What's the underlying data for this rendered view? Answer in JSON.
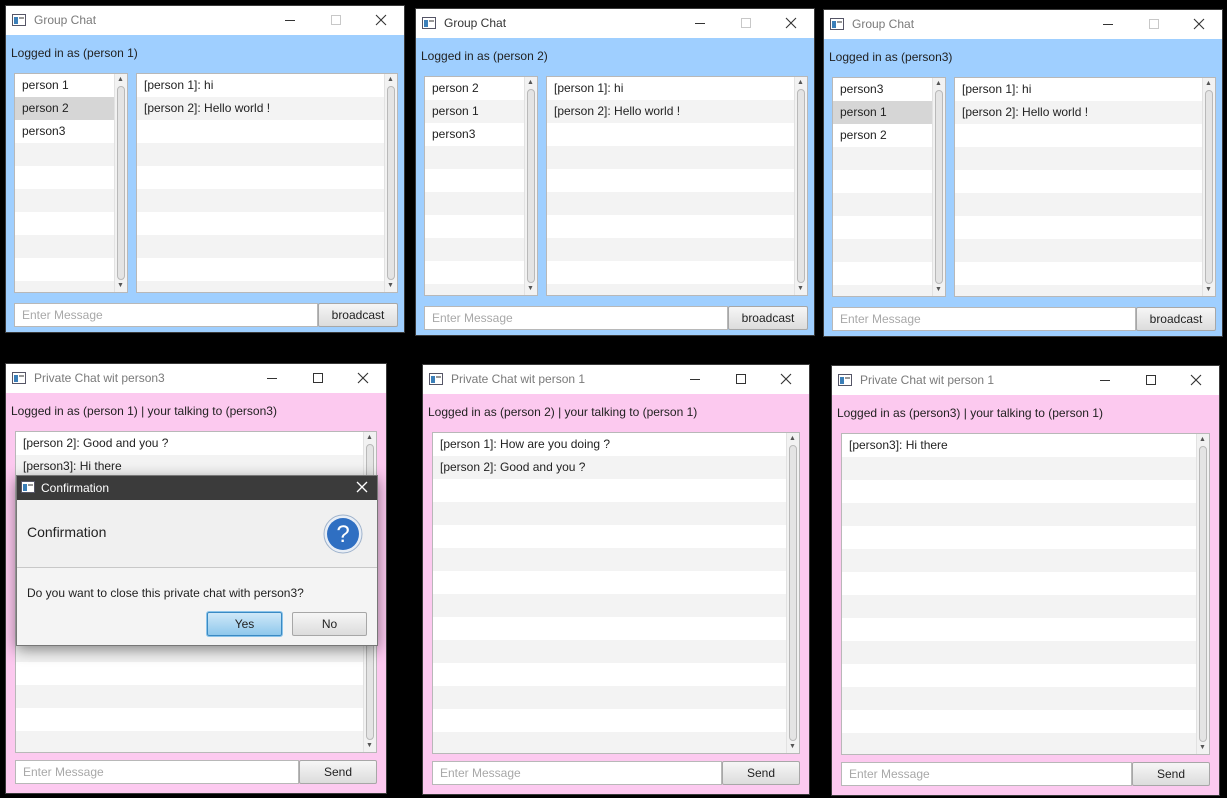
{
  "group_windows": [
    {
      "title": "Group Chat",
      "status": "Logged in as (person 1)",
      "users": [
        "person 1",
        "person 2",
        "person3"
      ],
      "selected_user": "person 2",
      "messages": [
        "[person 1]: hi",
        "[person 2]: Hello world !"
      ],
      "input_placeholder": "Enter Message",
      "button": "broadcast"
    },
    {
      "title": "Group Chat",
      "status": "Logged in as (person 2)",
      "users": [
        "person 2",
        "person 1",
        "person3"
      ],
      "selected_user": "",
      "messages": [
        "[person 1]: hi",
        "[person 2]: Hello world !"
      ],
      "input_placeholder": "Enter Message",
      "button": "broadcast"
    },
    {
      "title": "Group Chat",
      "status": "Logged in as (person3)",
      "users": [
        "person3",
        "person 1",
        "person 2"
      ],
      "selected_user": "person 1",
      "messages": [
        "[person 1]: hi",
        "[person 2]: Hello world !"
      ],
      "input_placeholder": "Enter Message",
      "button": "broadcast"
    }
  ],
  "private_windows": [
    {
      "title": "Private Chat wit person3",
      "status": "Logged in as (person 1) | your talking to (person3)",
      "messages": [
        "[person 2]: Good and you ?",
        "[person3]: Hi there"
      ],
      "input_placeholder": "Enter Message",
      "button": "Send"
    },
    {
      "title": "Private Chat wit person 1",
      "status": "Logged in as (person 2) | your talking to (person 1)",
      "messages": [
        "[person 1]: How are you doing ?",
        "[person 2]: Good and you ?"
      ],
      "input_placeholder": "Enter Message",
      "button": "Send"
    },
    {
      "title": "Private Chat wit person 1",
      "status": "Logged in as (person3) | your talking to (person 1)",
      "messages": [
        "[person3]: Hi there"
      ],
      "input_placeholder": "Enter Message",
      "button": "Send"
    }
  ],
  "dialog": {
    "title": "Confirmation",
    "header": "Confirmation",
    "message": "Do you want to close this private chat with person3?",
    "yes_label": "Yes",
    "no_label": "No",
    "icon": "question-icon"
  },
  "colors": {
    "group_background": "#9fcfff",
    "private_background": "#fcc9ef",
    "dialog_titlebar": "#3b3b3b",
    "default_button_accent": "#3a8ac3"
  },
  "icons": [
    "app-icon",
    "minimize-icon",
    "maximize-icon",
    "close-icon",
    "question-icon",
    "scroll-up-icon",
    "scroll-down-icon"
  ]
}
